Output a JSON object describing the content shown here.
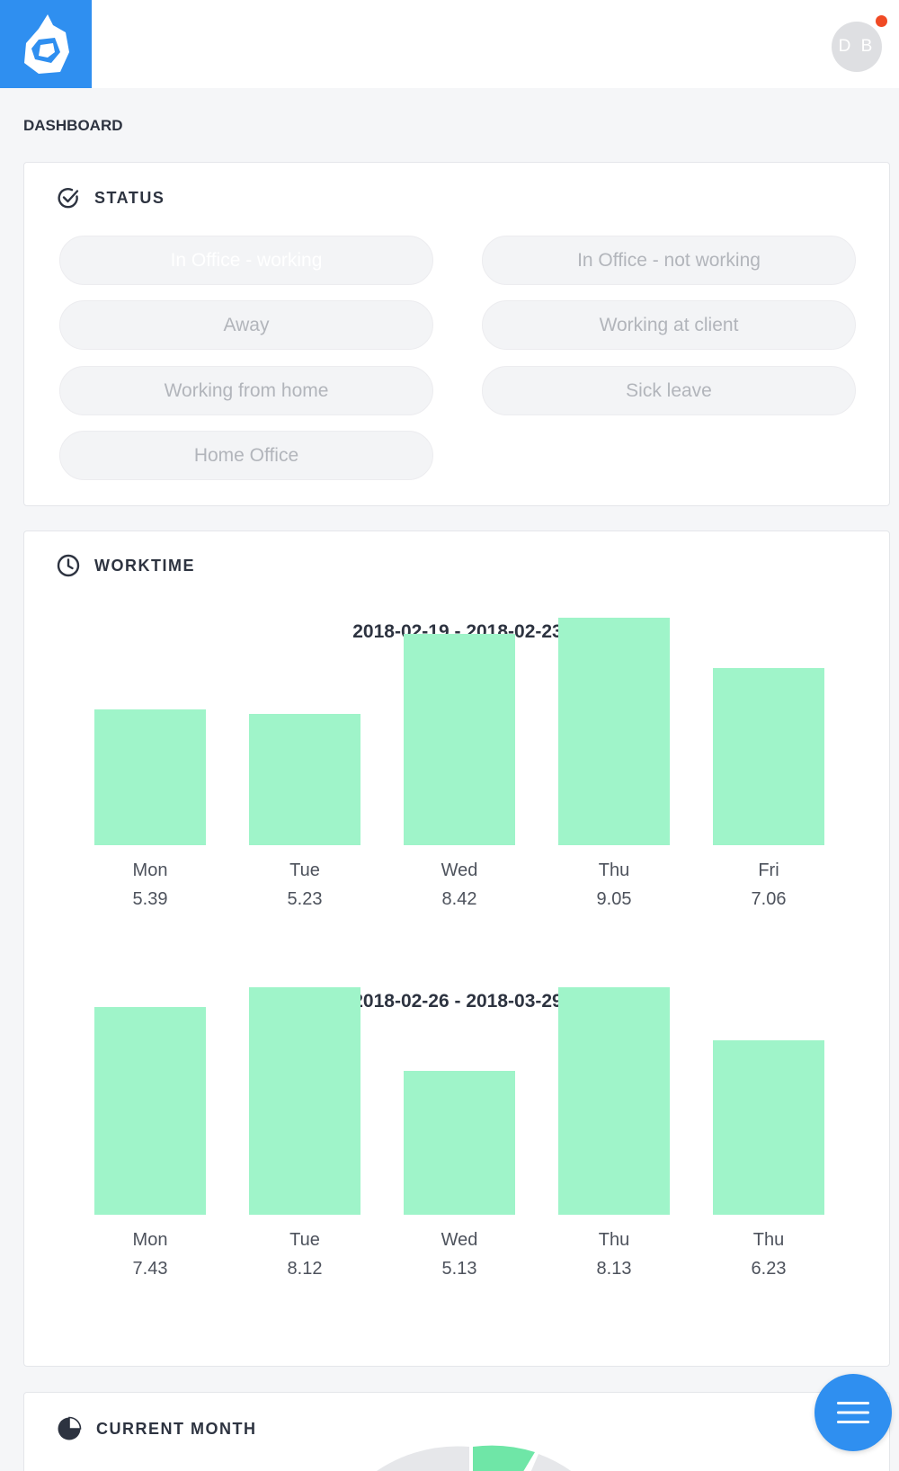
{
  "header": {
    "logo_icon": "app-logo-icon",
    "avatar_initials": "D B",
    "notification_color": "#f04a24",
    "brand_color": "#2f8ff0"
  },
  "page": {
    "title": "DASHBOARD"
  },
  "status": {
    "title": "STATUS",
    "icon": "check-circle-icon",
    "options": [
      {
        "label": "In Office - working",
        "active": true
      },
      {
        "label": "In Office - not working",
        "active": false
      },
      {
        "label": "Away",
        "active": false
      },
      {
        "label": "Working at client",
        "active": false
      },
      {
        "label": "Working from home",
        "active": false
      },
      {
        "label": "Sick leave",
        "active": false
      },
      {
        "label": "Home Office",
        "active": false
      }
    ]
  },
  "worktime": {
    "title": "WORKTIME",
    "icon": "clock-icon"
  },
  "chart_data": [
    {
      "type": "bar",
      "title": "2018-02-19 - 2018-02-23",
      "categories": [
        "Mon",
        "Tue",
        "Wed",
        "Thu",
        "Fri"
      ],
      "values": [
        5.39,
        5.23,
        8.42,
        9.05,
        7.06
      ],
      "value_labels": [
        "5.39",
        "5.23",
        "8.42",
        "9.05",
        "7.06"
      ],
      "ylim": [
        0,
        9.05
      ],
      "color": "#9ff4c9",
      "grid": false
    },
    {
      "type": "bar",
      "title": "2018-02-26 - 2018-03-29",
      "categories": [
        "Mon",
        "Tue",
        "Wed",
        "Thu",
        "Thu"
      ],
      "values": [
        7.43,
        8.12,
        5.13,
        8.13,
        6.23
      ],
      "value_labels": [
        "7.43",
        "8.12",
        "5.13",
        "8.13",
        "6.23"
      ],
      "ylim": [
        0,
        8.13
      ],
      "color": "#9ff4c9",
      "grid": false
    }
  ],
  "current_month": {
    "title": "CURRENT MONTH",
    "icon": "pie-chart-icon"
  },
  "fab": {
    "icon": "menu-icon"
  }
}
